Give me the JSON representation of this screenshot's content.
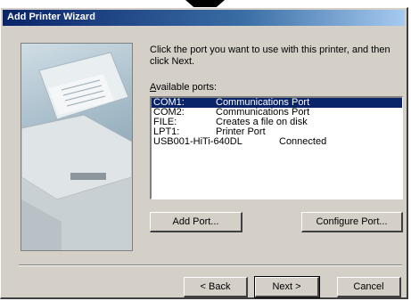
{
  "window": {
    "title": "Add Printer Wizard"
  },
  "instruction": "Click the port you want to use with this printer, and then click Next.",
  "ports_label": "Available ports:",
  "ports": [
    {
      "name": "COM1:",
      "description": "Communications Port",
      "status": "",
      "selected": true
    },
    {
      "name": "COM2:",
      "description": "Communications Port",
      "status": "",
      "selected": false
    },
    {
      "name": "FILE:",
      "description": "Creates a file on disk",
      "status": "",
      "selected": false
    },
    {
      "name": "LPT1:",
      "description": "Printer Port",
      "status": "",
      "selected": false
    },
    {
      "name": "USB001-HiTi-640DL",
      "description": "",
      "status": "Connected",
      "selected": false
    }
  ],
  "buttons": {
    "add_port": "Add Port...",
    "configure_port": "Configure Port...",
    "back": "< Back",
    "next": "Next >",
    "cancel": "Cancel"
  },
  "colors": {
    "title_bar": "#0a246a",
    "selection": "#0a246a",
    "dialog_bg": "#d4d0c8"
  }
}
